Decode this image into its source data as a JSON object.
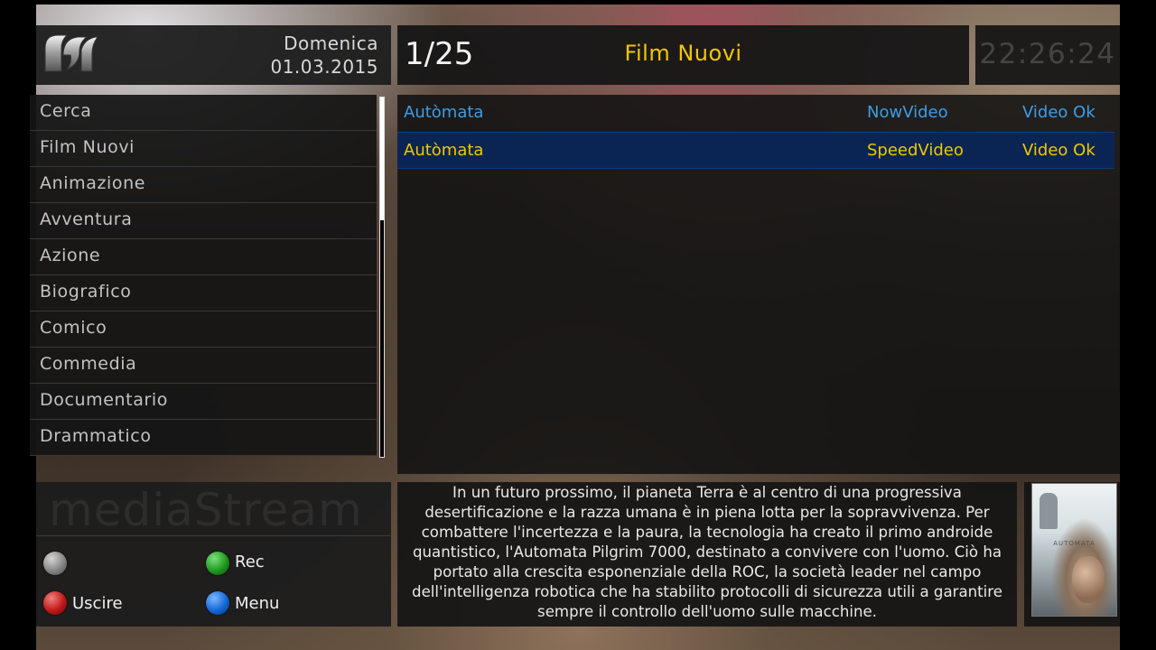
{
  "header": {
    "logo_name": "mediastream-logo",
    "day": "Domenica",
    "date": "01.03.2015",
    "page_counter": "1/25",
    "section_title": "Film Nuovi",
    "clock": "22:26:24"
  },
  "sidebar": {
    "items": [
      {
        "label": "Cerca"
      },
      {
        "label": "Film Nuovi"
      },
      {
        "label": "Animazione"
      },
      {
        "label": "Avventura"
      },
      {
        "label": "Azione"
      },
      {
        "label": "Biografico"
      },
      {
        "label": "Comico"
      },
      {
        "label": "Commedia"
      },
      {
        "label": "Documentario"
      },
      {
        "label": "Drammatico"
      }
    ]
  },
  "list": {
    "rows": [
      {
        "title": "Autòmata",
        "host": "NowVideo",
        "status": "Video Ok",
        "selected": false
      },
      {
        "title": "Autòmata",
        "host": "SpeedVideo",
        "status": "Video Ok",
        "selected": true
      }
    ]
  },
  "brand": {
    "watermark": "mediaStream"
  },
  "buttons": {
    "grey": {
      "label": "",
      "color": "#888888"
    },
    "green": {
      "label": "Rec",
      "color": "#1e9a1e"
    },
    "red": {
      "label": "Uscire",
      "color": "#c21818"
    },
    "blue": {
      "label": "Menu",
      "color": "#1467d8"
    }
  },
  "description": {
    "text": "In un futuro prossimo, il pianeta Terra è al centro di una progressiva desertificazione e la razza umana è in piena lotta per la sopravvivenza. Per combattere l'incertezza e la paura, la tecnologia ha creato il primo androide quantistico, l'Automata Pilgrim 7000, destinato a convivere con l'uomo. Ciò ha portato alla crescita esponenziale della ROC, la società leader nel campo dell'intelligenza robotica che ha stabilito protocolli di sicurezza utili a garantire sempre il controllo dell'uomo sulle macchine."
  },
  "poster": {
    "title_text": "AUTOMATA"
  },
  "colors": {
    "accent_yellow": "#f0c800",
    "link_blue": "#3a9ee6",
    "selection_bg": "#0a2553"
  }
}
